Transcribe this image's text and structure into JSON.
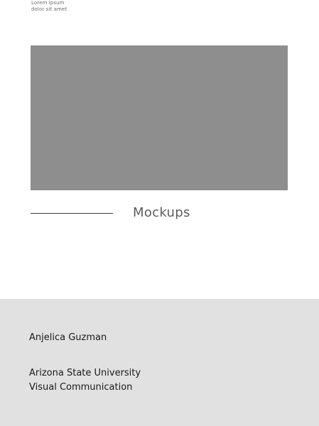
{
  "header": {
    "caption_line1": "Lorem ipsum",
    "caption_line2": "dolor sit amet"
  },
  "section": {
    "title": "Mockups"
  },
  "footer": {
    "author": "Anjelica Guzman",
    "university": "Arizona State University",
    "department": "Visual Communication"
  },
  "colors": {
    "placeholder": "#8e8e8e",
    "footer_background": "#e1e1e1",
    "rule": "#3a3a3a"
  }
}
